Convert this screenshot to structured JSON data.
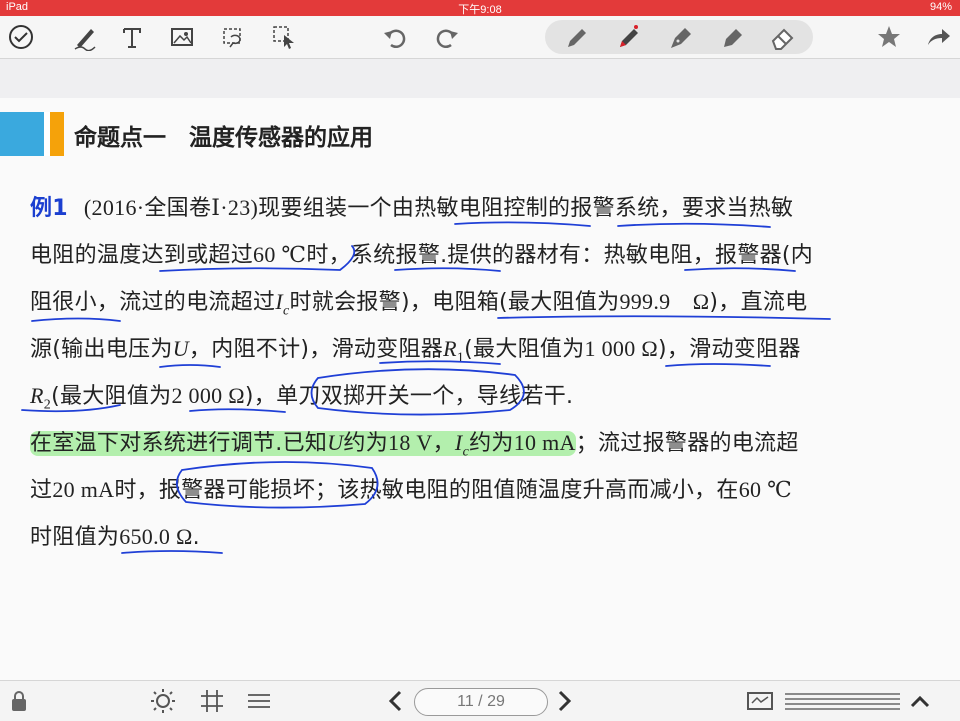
{
  "status_bar": {
    "device": "iPad",
    "time": "下午9:08",
    "battery": "94%"
  },
  "toolbar": {
    "left_icons": [
      "check-circle-icon",
      "pen-scribble-icon",
      "text-icon",
      "image-icon",
      "lasso-icon",
      "select-icon"
    ],
    "undo_icon": "undo-icon",
    "redo_icon": "redo-icon",
    "pen_tools": [
      "pen-gray-icon",
      "pen-red-active-icon",
      "fountain-pen-icon",
      "marker-icon",
      "eraser-icon"
    ],
    "right_icons": [
      "star-icon",
      "share-icon"
    ],
    "active_pen_color": "#d8202a"
  },
  "section": {
    "title": "命题点一　温度传感器的应用",
    "accent_blue": "#3aa9de",
    "accent_orange": "#f5a20a"
  },
  "problem": {
    "label": "例1",
    "l1": {
      "a": "(2016·全国卷Ⅰ·23)",
      "b": "现要组装一个由热敏电阻控制的报警系统，要求当热敏"
    },
    "l2": {
      "a": "电阻的温度达到或超过",
      "b": "60 ℃",
      "c": "时，系统报警.提供的器材有：热敏电阻，报警器(内"
    },
    "l3": {
      "a": "阻很小，流过的电流超过",
      "b": "I",
      "c": "c",
      "d": "时就会报警)，电阻箱(最大阻值为",
      "e": "999.9　Ω",
      "f": ")，直流电"
    },
    "l4": {
      "a": "源(输出电压为",
      "b": "U",
      "c": "，内阻不计)，滑动变阻器",
      "d": "R",
      "e": "1",
      "f": "(最大阻值为",
      "g": "1 000 Ω",
      "h": ")，滑动变阻器"
    },
    "l5": {
      "a": "R",
      "b": "2",
      "c": "(最大阻值为",
      "d": "2 000 Ω",
      "e": ")，单刀双掷开关一个，导线若干."
    },
    "l6": {
      "a": "在室温下对系统进行调节.已知",
      "b": "U",
      "c": "约为",
      "d": "18 V",
      "e": "，",
      "f": "I",
      "g": "c",
      "h": "约为",
      "i": "10 mA",
      "j": "；流过报警器的电流超"
    },
    "l7": {
      "a": "过",
      "b": "20 mA",
      "c": "时，报警器可能损坏；该热敏电阻的阻值随温度升高而减小，在",
      "d": "60 ℃"
    },
    "l8": {
      "a": "时阻值为",
      "b": "650.0 Ω",
      "c": "."
    }
  },
  "annotations": {
    "ink_color": "#1f3fd6",
    "highlight_color": "#78e66e"
  },
  "bottom_bar": {
    "icons": [
      "lock-icon",
      "brightness-icon",
      "grid-icon",
      "list-icon",
      "prev-page-icon",
      "next-page-icon",
      "thumbnail-icon",
      "scrubber-icon",
      "expand-up-icon"
    ],
    "current_page": "11",
    "separator": "/",
    "total_pages": "29"
  }
}
